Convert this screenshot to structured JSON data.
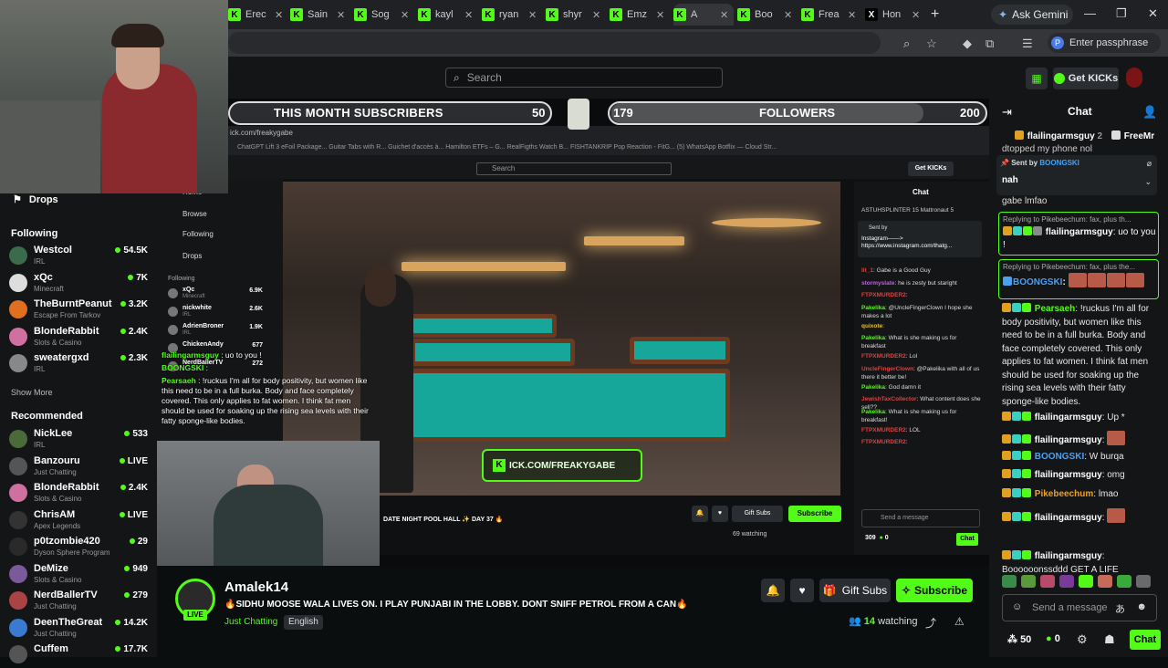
{
  "browser": {
    "tabs": [
      {
        "label": "Erec"
      },
      {
        "label": "Sain"
      },
      {
        "label": "Sog"
      },
      {
        "label": "kayl"
      },
      {
        "label": "ryan"
      },
      {
        "label": "shyr"
      },
      {
        "label": "Emz"
      },
      {
        "label": "A"
      },
      {
        "label": "Boo"
      },
      {
        "label": "Frea"
      },
      {
        "label": "Hon"
      }
    ],
    "ask_gemini": "Ask Gemini",
    "passphrase": "Enter passphrase",
    "passphrase_avatar": "P"
  },
  "topbar": {
    "search_placeholder": "Search",
    "get_kicks": "Get KICKs"
  },
  "sidebar": {
    "drops": "Drops",
    "following_title": "Following",
    "following": [
      {
        "name": "Westcol",
        "category": "IRL",
        "viewers": "54.5K",
        "color": "#3a6b4a"
      },
      {
        "name": "xQc",
        "category": "Minecraft",
        "viewers": "7K",
        "color": "#dddddd"
      },
      {
        "name": "TheBurntPeanut",
        "category": "Escape From Tarkov",
        "viewers": "3.2K",
        "color": "#e07020"
      },
      {
        "name": "BlondeRabbit",
        "category": "Slots & Casino",
        "viewers": "2.4K",
        "color": "#d070a0"
      },
      {
        "name": "sweatergxd",
        "category": "IRL",
        "viewers": "2.3K",
        "color": "#888888"
      }
    ],
    "show_more": "Show More",
    "recommended_title": "Recommended",
    "recommended": [
      {
        "name": "NickLee",
        "category": "IRL",
        "viewers": "533",
        "color": "#4a6a3a"
      },
      {
        "name": "Banzouru",
        "category": "Just Chatting",
        "viewers": "LIVE",
        "color": "#555555"
      },
      {
        "name": "BlondeRabbit",
        "category": "Slots & Casino",
        "viewers": "2.4K",
        "color": "#d070a0"
      },
      {
        "name": "ChrisAM",
        "category": "Apex Legends",
        "viewers": "LIVE",
        "color": "#333333"
      },
      {
        "name": "p0tzombie420",
        "category": "Dyson Sphere Program",
        "viewers": "29",
        "color": "#2a2a2a"
      },
      {
        "name": "DeMize",
        "category": "Slots & Casino",
        "viewers": "949",
        "color": "#7a5a9a"
      },
      {
        "name": "NerdBallerTV",
        "category": "Just Chatting",
        "viewers": "279",
        "color": "#aa4444"
      },
      {
        "name": "DeenTheGreat",
        "category": "Just Chatting",
        "viewers": "14.2K",
        "color": "#3a7ad0"
      },
      {
        "name": "Cuffem",
        "category": "",
        "viewers": "17.7K",
        "color": "#555555"
      }
    ]
  },
  "overlay": {
    "subs_label": "THIS MONTH SUBSCRIBERS",
    "subs_count": "50",
    "followers_current": "179",
    "followers_label": "FOLLOWERS",
    "followers_goal": "200",
    "kick_url": "ICK.COM/FREAKYGABE"
  },
  "embed": {
    "address": "ick.com/freakygabe",
    "bookmarks": "ChatGPT   Lift 3 eFoil Package...   Guitar Tabs with R...   Guichet d'accès à...   Hamilton ETFs – G...   RealFigths Watch B...   FISHTANKRIP   Pop Reaction - FitG...   (5) WhatsApp   Botflix — Cloud Str...",
    "search": "Search",
    "get_kicks": "Get KICKs",
    "nav": [
      "Home",
      "Browse",
      "Following",
      "Drops"
    ],
    "following_title": "Following",
    "channels": [
      {
        "name": "xQc",
        "cat": "Minecraft",
        "v": "6.9K"
      },
      {
        "name": "nickwhite",
        "cat": "IRL",
        "v": "2.6K"
      },
      {
        "name": "AdrienBroner",
        "cat": "IRL",
        "v": "1.9K"
      },
      {
        "name": "ChickenAndy",
        "cat": "",
        "v": "677"
      },
      {
        "name": "NerdBallerTV",
        "cat": "",
        "v": "272"
      }
    ],
    "overlay_chat": [
      {
        "user": "flailingarmsguy",
        "text": " : uo to you !"
      },
      {
        "user": "BOONGSKI",
        "text": " :"
      },
      {
        "user": "Pearsaeh",
        "text": " : !ruckus I'm all for body positivity, but women like this need to be in a full burka. Body and face completely covered. This only applies to fat women. I think fat men should be used for soaking up the rising sea levels with their fatty sponge-like bodies."
      }
    ],
    "stream_title": "DATE NIGHT POOL HALL ✨ DAY 37 🔥",
    "gift_subs": "Gift Subs",
    "subscribe": "Subscribe",
    "watching": "69 watching",
    "chat_title": "Chat",
    "chat_top": "ASTUHSPLINTER 15   Mattronaut 5",
    "pinned_by": "Sent by",
    "pinned_text": "Instagram——> https://www.instagram.com/thatg...",
    "messages": [
      {
        "user": "lit_1",
        "text": ": Gabe is a Good Guy",
        "color": "#e04040"
      },
      {
        "user": "stormyslate",
        "text": ": he is zesty but staright",
        "color": "#c060e0"
      },
      {
        "user": "FTPXMURDER2",
        "text": ":",
        "color": "#e04040"
      },
      {
        "user": "Pakelika",
        "text": ": @UncleFingerClown I hope she makes a lot",
        "color": "#53fc18"
      },
      {
        "user": "quixote",
        "text": ":",
        "color": "#e0c040"
      },
      {
        "user": "Pakelika",
        "text": ": What is she making us for breakfast",
        "color": "#53fc18"
      },
      {
        "user": "FTPXMURDER2",
        "text": ": Lol",
        "color": "#e04040"
      },
      {
        "user": "UncleFingerClown",
        "text": ": @Pakelika with all of us there it better be!",
        "color": "#e04040"
      },
      {
        "user": "Pakelika",
        "text": ": God damn it",
        "color": "#53fc18"
      },
      {
        "user": "JewishTaxCollector",
        "text": ": What content does she sell??",
        "color": "#e04040"
      },
      {
        "user": "Pakelika",
        "text": ": What is she making us for breakfast!",
        "color": "#53fc18"
      },
      {
        "user": "FTPXMURDER2",
        "text": ": LOL",
        "color": "#e04040"
      },
      {
        "user": "FTPXMURDER2",
        "text": ":",
        "color": "#e04040"
      }
    ],
    "send_placeholder": "Send a message",
    "points": "309",
    "kicks": "0",
    "chat_button": "Chat"
  },
  "stream": {
    "streamer": "Amalek14",
    "live": "LIVE",
    "title": "🔥SIDHU MOOSE WALA LIVES ON.  I PLAY PUNJABI IN THE LOBBY. DONT SNIFF PETROL FROM A CAN🔥",
    "category": "Just Chatting",
    "language": "English",
    "gift_subs": "Gift Subs",
    "subscribe": "Subscribe",
    "watching_count": "14",
    "watching_label": " watching"
  },
  "chat": {
    "title": "Chat",
    "top_gifters": [
      {
        "name": "flailingarmsguy",
        "count": "2"
      },
      {
        "name": "FreeMr",
        "count": ""
      }
    ],
    "scroll_text": "dtopped my phone nol",
    "pinned_by_label": "Sent by",
    "pinned_by_user": "BOONGSKI",
    "pinned_text": "nah",
    "partial_line": "gabe lmfao",
    "reply1_context": "Replying to Pikebeechum: fax, plus th...",
    "reply1_user": "flailingarmsguy",
    "reply1_text": ": uo to you !",
    "reply2_context": "Replying to Pikebeechum: fax, plus the...",
    "reply2_user": "BOONGSKI",
    "reply2_text": ":",
    "messages": [
      {
        "user": "Pearsaeh",
        "color": "#53fc18",
        "text": ": !ruckus I'm all for body positivity, but women like this need to be in a full burka. Body and face completely covered. This only applies to fat women. I think fat men should be used for soaking up the rising sea levels with their fatty sponge-like bodies."
      },
      {
        "user": "flailingarmsguy",
        "color": "#ffffff",
        "text": ": Up *"
      },
      {
        "user": "flailingarmsguy",
        "color": "#ffffff",
        "text": ":"
      },
      {
        "user": "BOONGSKI",
        "color": "#4aa0f0",
        "text": ": W burqa"
      },
      {
        "user": "flailingarmsguy",
        "color": "#ffffff",
        "text": ": omg"
      },
      {
        "user": "Pikebeechum",
        "color": "#f0a020",
        "text": ": lmao"
      },
      {
        "user": "flailingarmsguy",
        "color": "#ffffff",
        "text": ":"
      },
      {
        "user": "flailingarmsguy",
        "color": "#ffffff",
        "text": ": Boooooonssddd GET A LIFE"
      }
    ],
    "send_placeholder": "Send a message",
    "points": "50",
    "kicks": "0",
    "chat_button": "Chat"
  },
  "colors": {
    "accent": "#53fc18",
    "background": "#0b0e0f",
    "panel": "#141517"
  }
}
